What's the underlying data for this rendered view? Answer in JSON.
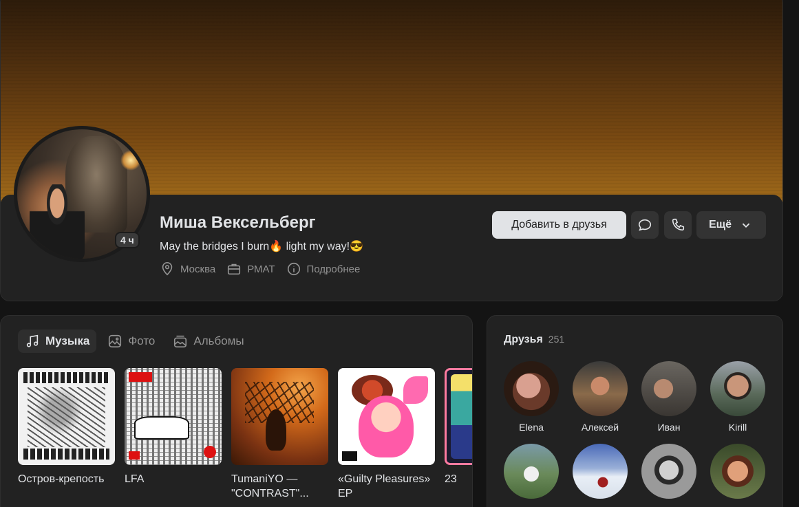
{
  "profile": {
    "name": "Миша Вексельберг",
    "status": "May the bridges I burn🔥 light my way!😎",
    "online": "4 ч",
    "city": "Москва",
    "work": "РМАТ",
    "details": "Подробнее"
  },
  "actions": {
    "add_friend": "Добавить в друзья",
    "more": "Ещё"
  },
  "media": {
    "tabs": [
      {
        "label": "Музыка",
        "icon": "music-note-icon",
        "active": true
      },
      {
        "label": "Фото",
        "icon": "photo-icon",
        "active": false
      },
      {
        "label": "Альбомы",
        "icon": "albums-icon",
        "active": false
      }
    ],
    "albums": [
      {
        "title": "Остров-крепость"
      },
      {
        "title": "LFA"
      },
      {
        "title": "TumaniYO — \"CONTRAST\"..."
      },
      {
        "title": "«Guilty Pleasures» EP"
      },
      {
        "title": "23"
      }
    ]
  },
  "friends": {
    "title": "Друзья",
    "count": "251",
    "items": [
      {
        "name": "Elena"
      },
      {
        "name": "Алексей"
      },
      {
        "name": "Иван"
      },
      {
        "name": "Kirill"
      },
      {
        "name": ""
      },
      {
        "name": ""
      },
      {
        "name": ""
      },
      {
        "name": ""
      }
    ]
  },
  "colors": {
    "background": "#141414",
    "card": "#222222",
    "primary_button": "#e1e3e6",
    "secondary_button": "#333333",
    "muted_text": "#939393"
  }
}
